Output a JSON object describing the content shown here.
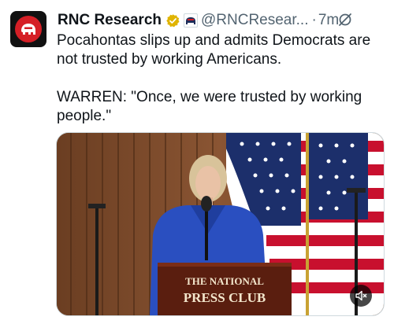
{
  "post": {
    "display_name": "RNC Research",
    "handle": "@RNCResear...",
    "separator": "·",
    "time": "7m",
    "text": "Pocahontas slips up and admits Democrats are not trusted by working Americans.\n\nWARREN: \"Once, we were trusted by working people.\"",
    "avatar_icon": "rnc-elephant-icon",
    "verified_color": "#e0b400"
  },
  "media": {
    "type": "video",
    "podium_line1": "THE NATIONAL",
    "podium_line2": "PRESS CLUB"
  }
}
